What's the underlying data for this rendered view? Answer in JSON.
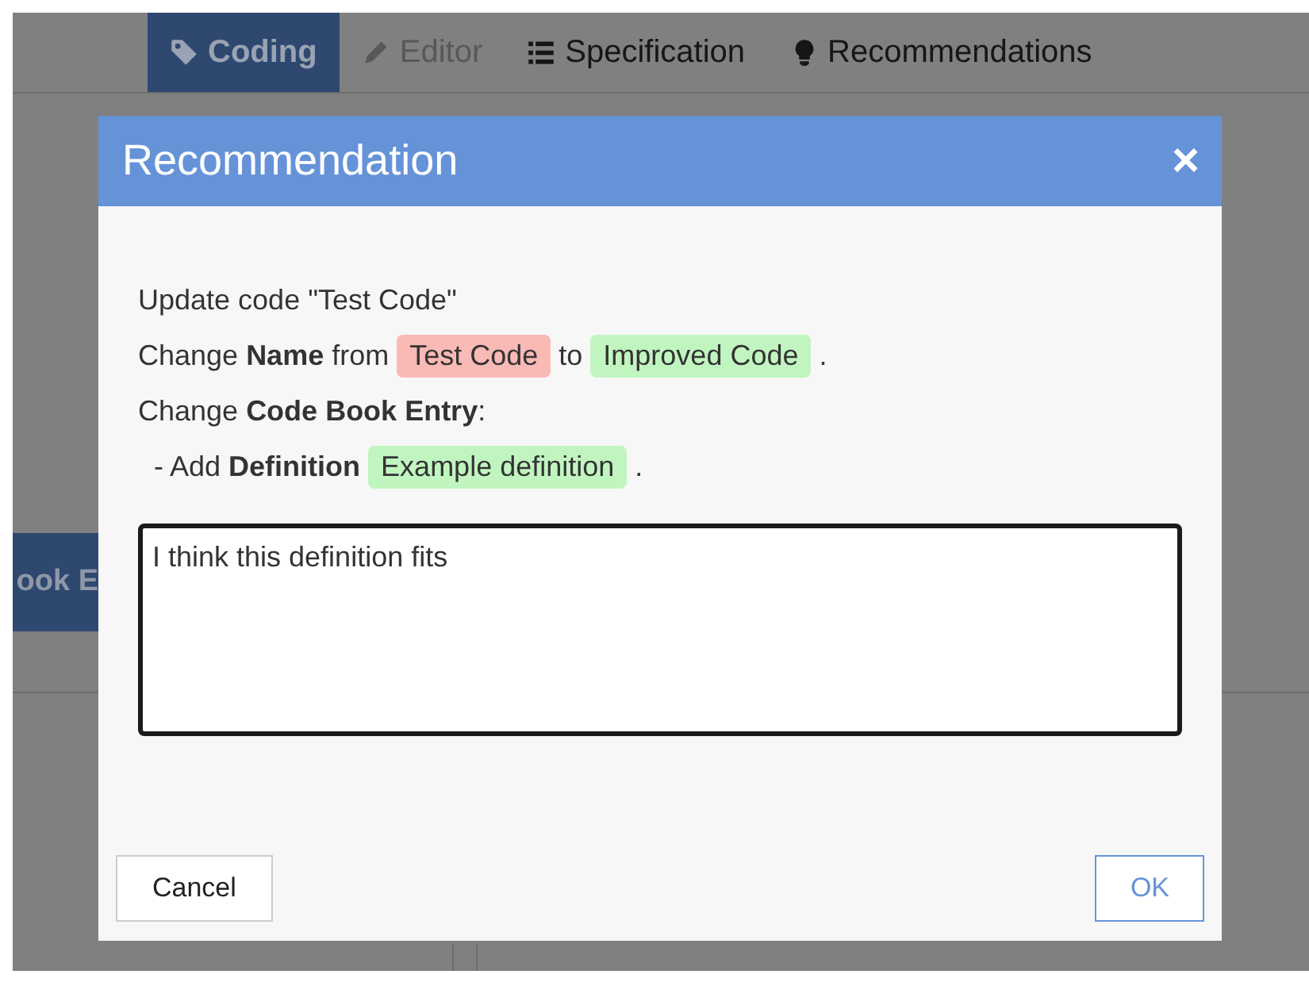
{
  "tabs": [
    {
      "label": "Coding",
      "kind": "tag",
      "selected": true,
      "disabled": false
    },
    {
      "label": "Editor",
      "kind": "pencil",
      "selected": false,
      "disabled": true
    },
    {
      "label": "Specification",
      "kind": "list",
      "selected": false,
      "disabled": false
    },
    {
      "label": "Recommendations",
      "kind": "bulb",
      "selected": false,
      "disabled": false
    }
  ],
  "background_button": {
    "label": "ook E"
  },
  "dialog": {
    "title": "Recommendation",
    "close": "×",
    "lines": [
      [
        {
          "kind": "text",
          "text": "Update code \"Test Code\""
        }
      ],
      [
        {
          "kind": "text",
          "text": "Change **Name** from"
        },
        {
          "kind": "removed",
          "text": "Test Code"
        },
        {
          "kind": "text",
          "text": "to"
        },
        {
          "kind": "added",
          "text": "Improved Code"
        },
        {
          "kind": "text",
          "text": "."
        }
      ],
      [
        {
          "kind": "text",
          "text": "Change **Code Book Entry**:"
        }
      ],
      [
        {
          "kind": "text",
          "text": "  - Add **Definition**"
        },
        {
          "kind": "added",
          "text": "Example definition"
        },
        {
          "kind": "text",
          "text": "."
        }
      ]
    ],
    "comment": {
      "value": "I think this definition fits"
    },
    "buttons": [
      {
        "label": "Cancel",
        "kind": "secondary"
      },
      {
        "label": "OK",
        "kind": "primary"
      }
    ]
  }
}
